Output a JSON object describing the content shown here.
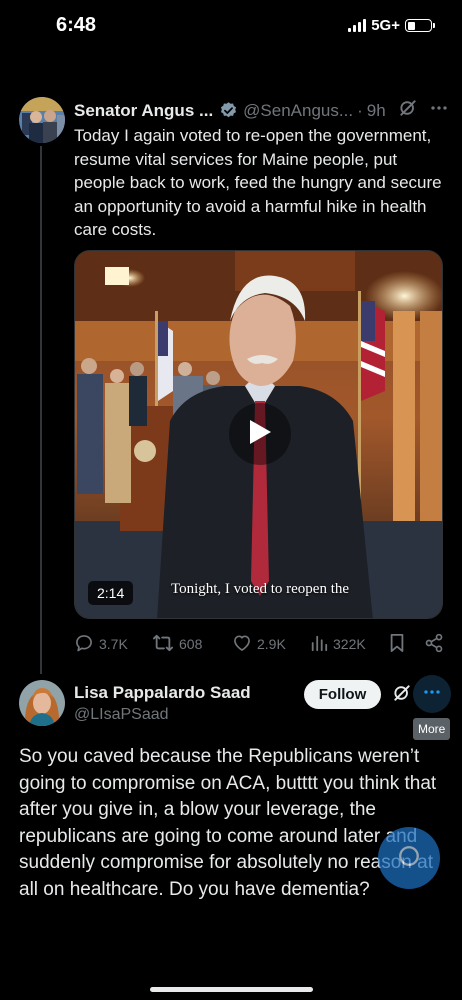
{
  "status_bar": {
    "time": "6:48",
    "network": "5G+",
    "battery_level": 0.35
  },
  "post": {
    "author_name": "Senator Angus ...",
    "handle": "@SenAngus...",
    "dot": "·",
    "time_ago": "9h",
    "text": "Today I again voted to re-open the government, resume vital services for Maine people, put people back to work, feed the hungry and secure an opportunity to avoid a harmful hike in health care costs.",
    "video": {
      "duration": "2:14",
      "caption": "Tonight, I voted to reopen the"
    },
    "stats": {
      "replies": "3.7K",
      "reposts": "608",
      "likes": "2.9K",
      "views": "322K"
    }
  },
  "reply": {
    "author_name": "Lisa Pappalardo Saad",
    "handle": "@LIsaPSaad",
    "follow_label": "Follow",
    "more_tooltip": "More",
    "text": "So you caved because the Republicans weren’t going to compromise on ACA, butttt you think that after you give in, a blow your leverage, the republicans are going to come around later and suddenly compromise for absolutely no reason at all on healthcare. Do you have dementia?"
  },
  "colors": {
    "accent": "#1d9bf0",
    "muted": "#71767b",
    "background": "#000000",
    "verified": "#829aab"
  }
}
